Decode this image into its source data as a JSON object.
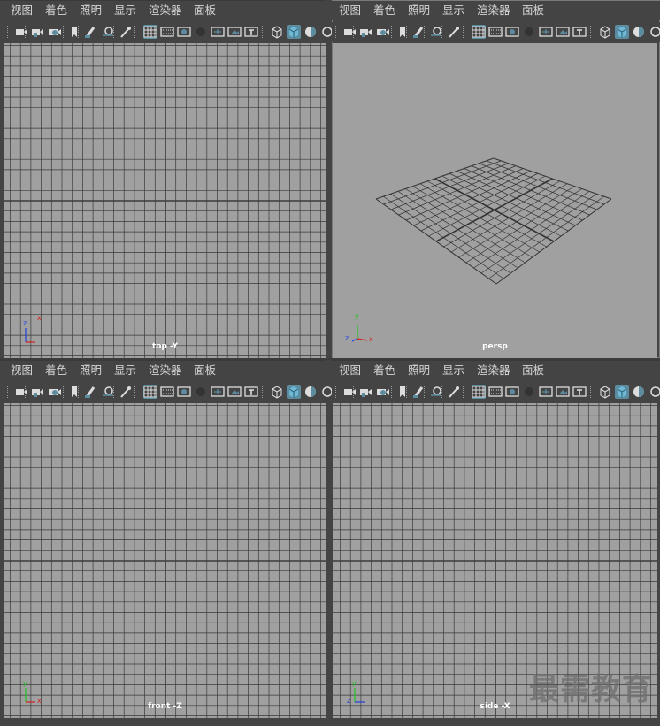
{
  "menu": [
    "视图",
    "着色",
    "照明",
    "显示",
    "渲染器",
    "面板"
  ],
  "toolbar_icons": [
    "select-camera-icon",
    "camera-attributes-icon",
    "bookmark-icon",
    "image-plane-icon",
    "grease-pencil-icon",
    "pivot-icon",
    "camera-tool-icon",
    "grid-icon",
    "film-gate-icon",
    "resolution-gate-icon",
    "gate-mask-icon",
    "field-chart-icon",
    "safe-action-icon",
    "safe-title-icon",
    "wireframe-icon",
    "smooth-shade-icon",
    "use-default-material-icon",
    "more-icon"
  ],
  "panels": [
    {
      "id": "top",
      "camera_label": "top -Y",
      "axes": {
        "vertical": "z",
        "horizontal": "x"
      }
    },
    {
      "id": "persp",
      "camera_label": "persp",
      "axes": {
        "vertical": "y",
        "depth": "z",
        "horizontal": "x"
      }
    },
    {
      "id": "front",
      "camera_label": "front -Z",
      "axes": {
        "vertical": "y",
        "horizontal": "x"
      }
    },
    {
      "id": "side",
      "camera_label": "side -X",
      "axes": {
        "vertical": "y",
        "horizontal": "z"
      }
    }
  ],
  "colors": {
    "viewport_bg": "#a0a0a0",
    "grid_line": "#3a3a3a",
    "ui_bg": "#444444",
    "active_icon": "#5c8ca0",
    "axis_x": "#d02020",
    "axis_y": "#20c020",
    "axis_z": "#2040e0"
  },
  "watermark": "最需教育"
}
